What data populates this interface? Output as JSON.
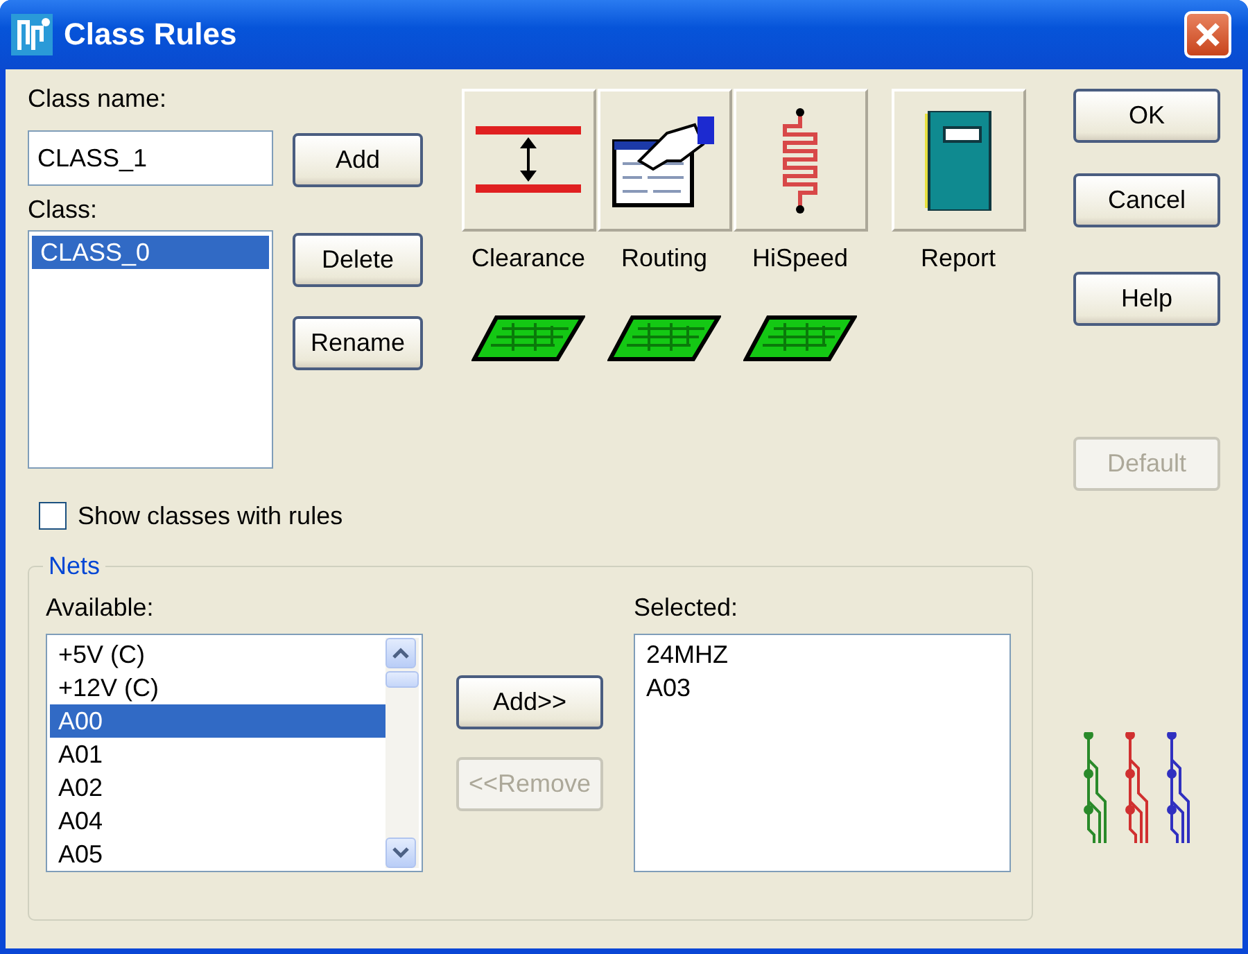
{
  "window": {
    "title": "Class Rules"
  },
  "class_name": {
    "label": "Class name:",
    "value": "CLASS_1"
  },
  "class_list": {
    "label": "Class:",
    "items": [
      {
        "label": "CLASS_0",
        "selected": true
      }
    ]
  },
  "class_buttons": [
    {
      "label": "Add",
      "disabled": false
    },
    {
      "label": "Delete",
      "disabled": false
    },
    {
      "label": "Rename",
      "disabled": false
    }
  ],
  "rules": [
    {
      "kind": "clearance",
      "label": "Clearance",
      "assigned": true
    },
    {
      "kind": "routing",
      "label": "Routing",
      "assigned": true
    },
    {
      "kind": "hispeed",
      "label": "HiSpeed",
      "assigned": true
    },
    {
      "kind": "report",
      "label": "Report",
      "assigned": false
    }
  ],
  "dialog_buttons": [
    {
      "label": "OK",
      "disabled": false
    },
    {
      "label": "Cancel",
      "disabled": false
    },
    {
      "label": "Help",
      "disabled": false
    },
    {
      "label": "Default",
      "disabled": true
    }
  ],
  "show_classes_with_rules": {
    "label": "Show classes with rules",
    "checked": false
  },
  "nets": {
    "title": "Nets",
    "available": {
      "label": "Available:",
      "items": [
        {
          "label": "+5V  (C)",
          "selected": false
        },
        {
          "label": "+12V  (C)",
          "selected": false
        },
        {
          "label": "A00",
          "selected": true
        },
        {
          "label": "A01",
          "selected": false
        },
        {
          "label": "A02",
          "selected": false
        },
        {
          "label": "A04",
          "selected": false
        },
        {
          "label": "A05",
          "selected": false
        }
      ]
    },
    "buttons": [
      {
        "label": "Add>>",
        "disabled": false
      },
      {
        "label": "<<Remove",
        "disabled": true
      }
    ],
    "selected": {
      "label": "Selected:",
      "items": [
        {
          "label": "24MHZ",
          "selected": false
        },
        {
          "label": "A03",
          "selected": false
        }
      ]
    }
  }
}
